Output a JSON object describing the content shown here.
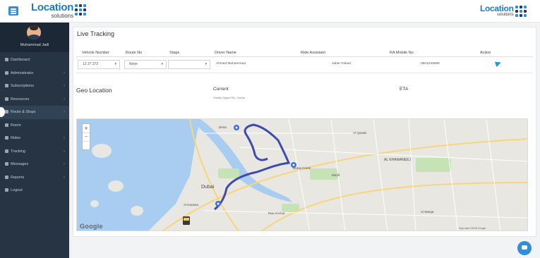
{
  "header": {
    "logo_word": "Location",
    "logo_sub": "solutions",
    "right_logo_word": "Location",
    "right_logo_sub": "solutions"
  },
  "sidebar": {
    "user_name": "Muhammad Jadi",
    "items": [
      {
        "label": "Dashboard",
        "icon": "dashboard-icon",
        "chevron": false
      },
      {
        "label": "Administrator",
        "icon": "admin-icon",
        "chevron": true
      },
      {
        "label": "Subscriptions",
        "icon": "user-icon",
        "chevron": true
      },
      {
        "label": "Resources",
        "icon": "resources-icon",
        "chevron": true
      },
      {
        "label": "Route & Stops",
        "icon": "route-icon",
        "chevron": true
      },
      {
        "label": "Room",
        "icon": "room-icon",
        "chevron": false
      },
      {
        "label": "Rides",
        "icon": "rides-icon",
        "chevron": true
      },
      {
        "label": "Tracking",
        "icon": "tracking-icon",
        "chevron": true
      },
      {
        "label": "Messages",
        "icon": "messages-icon",
        "chevron": true
      },
      {
        "label": "Reports",
        "icon": "reports-icon",
        "chevron": true
      },
      {
        "label": "Logout",
        "icon": "logout-icon",
        "chevron": false
      }
    ]
  },
  "main": {
    "title": "Live Tracking",
    "table": {
      "headers": [
        "Vehicle Number",
        "Route No",
        "Stage",
        "Driver Name",
        "Ride Assistant",
        "RA Mobile No",
        "Action"
      ],
      "row": {
        "vehicle": "12 37 272",
        "route": "None",
        "stage": "",
        "driver": "Ahmed Muhammad",
        "assistant": "Jaber Fahad",
        "ra_mobile": "0501234589"
      }
    },
    "geo_title": "Geo Location",
    "current_title": "Current",
    "current_detail": "Sheikh Zayed Rd - Dubai",
    "eta_title": "ETA",
    "map": {
      "provider_label": "Google",
      "city_label": "Dubai",
      "labels": [
        "Al Karama",
        "Al Qusais",
        "AL KHAWANEEJ",
        "Al Warqa",
        "Dubai Creek",
        "Mirdif",
        "Ras Al Khor",
        "Deira"
      ],
      "attribution": "Map data ©2018 Google"
    }
  },
  "colors": {
    "accent": "#2f8fd8",
    "sidebar": "#273444",
    "route": "#3d4bb0"
  }
}
